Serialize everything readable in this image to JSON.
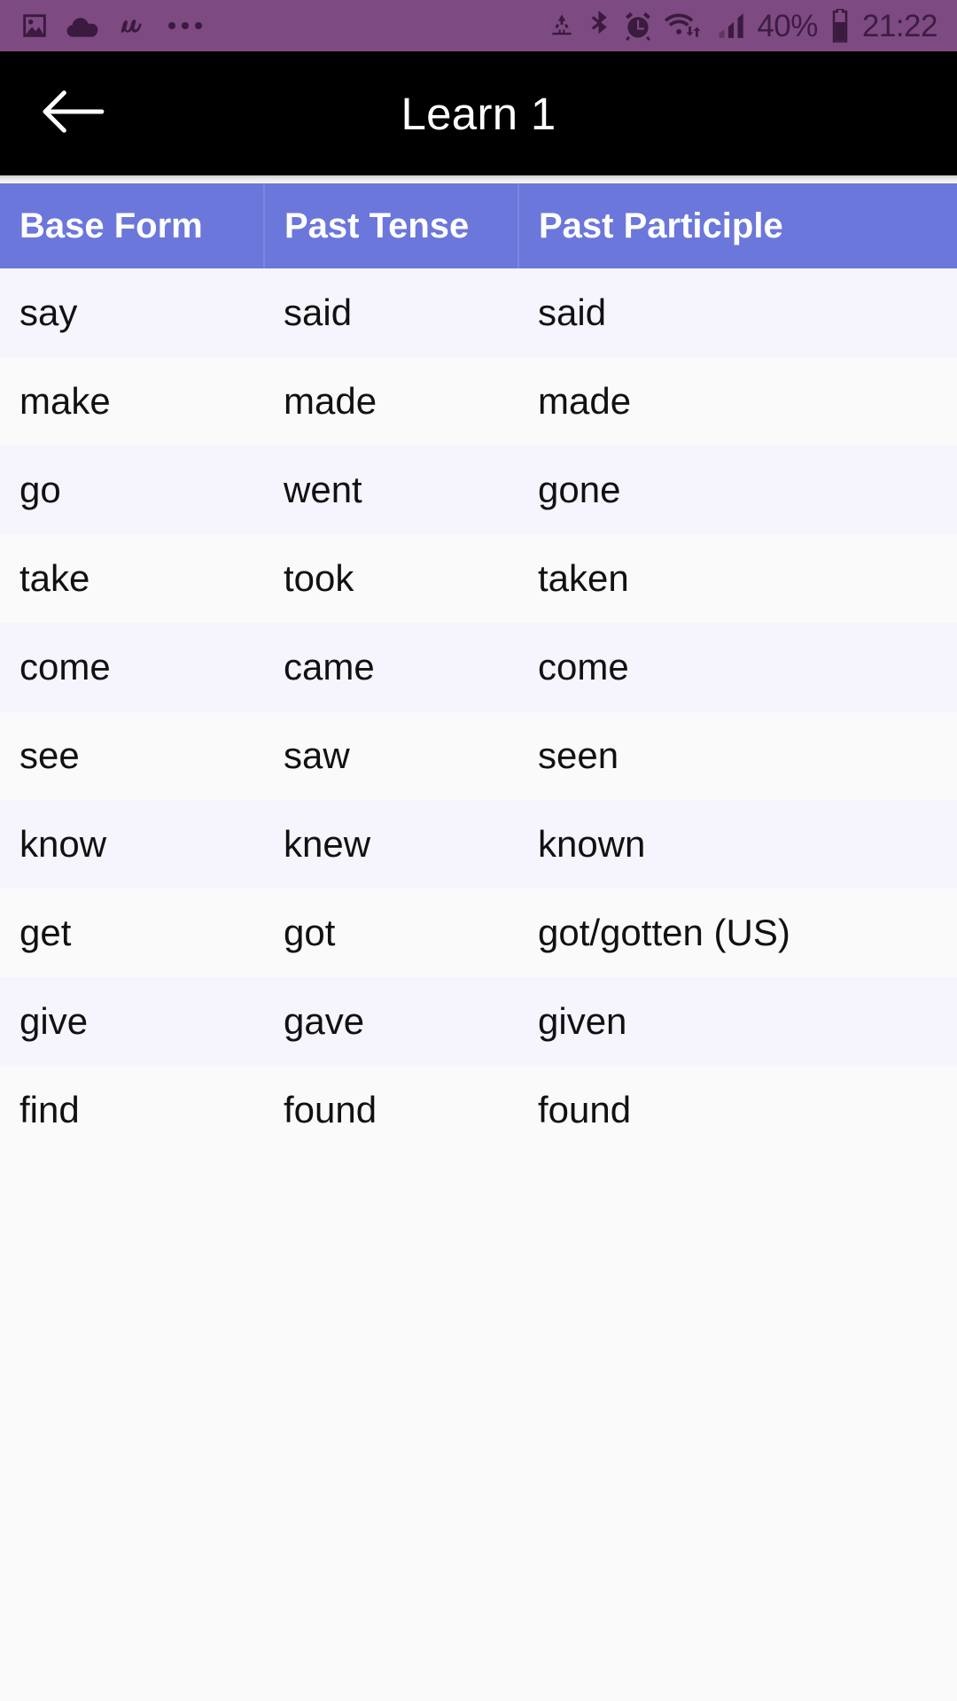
{
  "status_bar": {
    "background": "#7d4a82",
    "icon_color": "#3a1a3e",
    "left_icons": [
      "image-icon",
      "cloud-icon",
      "meetup-m-icon",
      "overflow-dots-icon"
    ],
    "right_icons": [
      "data-saver-icon",
      "bluetooth-icon",
      "alarm-icon",
      "wifi-icon",
      "cellular-signal-icon",
      "battery-icon"
    ],
    "battery_percent": "40%",
    "clock": "21:22"
  },
  "app_bar": {
    "background": "#000000",
    "back_icon": "arrow-left-icon",
    "title": "Learn 1"
  },
  "table": {
    "header_color": "#6b77db",
    "row_tint_color": "#f6f5fe",
    "row_base_color": "#fafafa",
    "columns": [
      "Base Form",
      "Past Tense",
      "Past Participle"
    ],
    "rows": [
      {
        "base": "say",
        "past": "said",
        "participle": "said"
      },
      {
        "base": "make",
        "past": "made",
        "participle": "made"
      },
      {
        "base": "go",
        "past": "went",
        "participle": "gone"
      },
      {
        "base": "take",
        "past": "took",
        "participle": "taken"
      },
      {
        "base": "come",
        "past": "came",
        "participle": "come"
      },
      {
        "base": "see",
        "past": "saw",
        "participle": "seen"
      },
      {
        "base": "know",
        "past": "knew",
        "participle": "known"
      },
      {
        "base": "get",
        "past": "got",
        "participle": "got/gotten (US)"
      },
      {
        "base": "give",
        "past": "gave",
        "participle": "given"
      },
      {
        "base": "find",
        "past": "found",
        "participle": "found"
      }
    ]
  }
}
